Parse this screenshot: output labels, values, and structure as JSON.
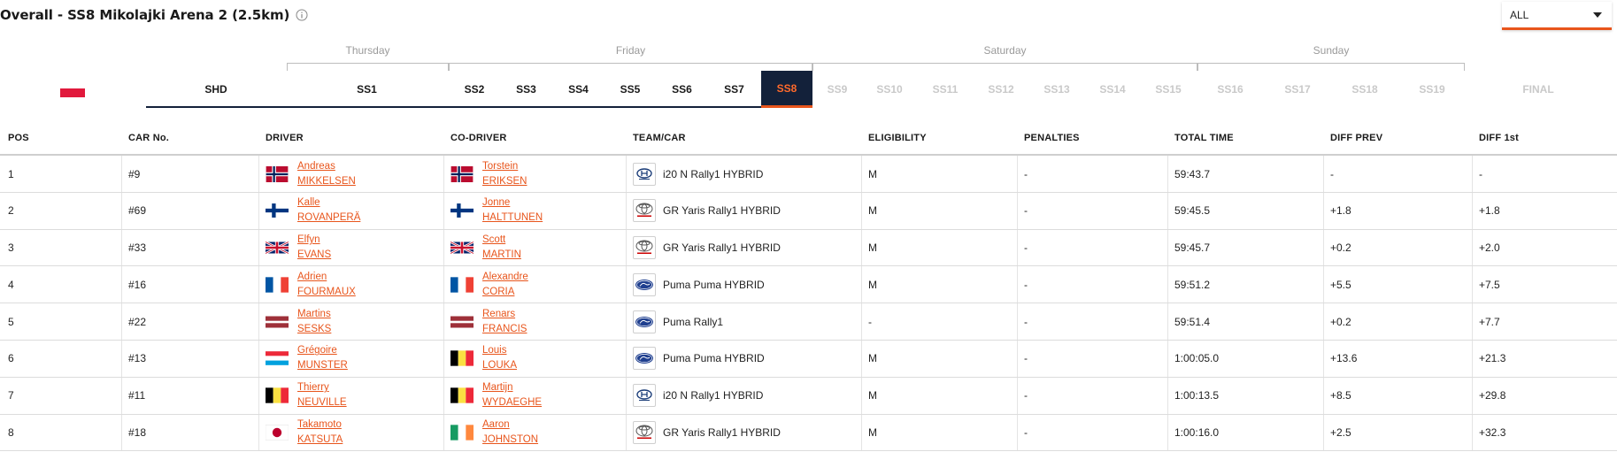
{
  "header": {
    "title": "Overall - SS8 Mikolajki Arena 2 (2.5km)",
    "filter_value": "ALL"
  },
  "days": [
    "Thursday",
    "Friday",
    "Saturday",
    "Sunday"
  ],
  "stages": [
    "SHD",
    "SS1",
    "SS2",
    "SS3",
    "SS4",
    "SS5",
    "SS6",
    "SS7",
    "SS8",
    "SS9",
    "SS10",
    "SS11",
    "SS12",
    "SS13",
    "SS14",
    "SS15",
    "SS16",
    "SS17",
    "SS18",
    "SS19",
    "FINAL"
  ],
  "active_stage": "SS8",
  "colors": {
    "accent": "#e8551c",
    "navy": "#13213a"
  },
  "columns": [
    "POS",
    "CAR No.",
    "DRIVER",
    "CO-DRIVER",
    "TEAM/CAR",
    "ELIGIBILITY",
    "PENALTIES",
    "TOTAL TIME",
    "DIFF PREV",
    "DIFF 1st"
  ],
  "rows": [
    {
      "pos": "1",
      "car": "#9",
      "driver_first": "Andreas",
      "driver_last": "MIKKELSEN",
      "driver_flag": "NOR",
      "codriver_first": "Torstein",
      "codriver_last": "ERIKSEN",
      "codriver_flag": "NOR",
      "logo": "hyundai-logo",
      "team": "i20 N Rally1 HYBRID",
      "elig": "M",
      "pen": "-",
      "total": "59:43.7",
      "diff_prev": "-",
      "diff_first": "-"
    },
    {
      "pos": "2",
      "car": "#69",
      "driver_first": "Kalle",
      "driver_last": "ROVANPERÄ",
      "driver_flag": "FIN",
      "codriver_first": "Jonne",
      "codriver_last": "HALTTUNEN",
      "codriver_flag": "FIN",
      "logo": "toyota-logo",
      "team": "GR Yaris Rally1 HYBRID",
      "elig": "M",
      "pen": "-",
      "total": "59:45.5",
      "diff_prev": "+1.8",
      "diff_first": "+1.8"
    },
    {
      "pos": "3",
      "car": "#33",
      "driver_first": "Elfyn",
      "driver_last": "EVANS",
      "driver_flag": "GBR",
      "codriver_first": "Scott",
      "codriver_last": "MARTIN",
      "codriver_flag": "GBR",
      "logo": "toyota-logo",
      "team": "GR Yaris Rally1 HYBRID",
      "elig": "M",
      "pen": "-",
      "total": "59:45.7",
      "diff_prev": "+0.2",
      "diff_first": "+2.0"
    },
    {
      "pos": "4",
      "car": "#16",
      "driver_first": "Adrien",
      "driver_last": "FOURMAUX",
      "driver_flag": "FRA",
      "codriver_first": "Alexandre",
      "codriver_last": "CORIA",
      "codriver_flag": "FRA",
      "logo": "ford-logo",
      "team": "Puma Puma HYBRID",
      "elig": "M",
      "pen": "-",
      "total": "59:51.2",
      "diff_prev": "+5.5",
      "diff_first": "+7.5"
    },
    {
      "pos": "5",
      "car": "#22",
      "driver_first": "Martins",
      "driver_last": "SESKS",
      "driver_flag": "LAT",
      "codriver_first": "Renars",
      "codriver_last": "FRANCIS",
      "codriver_flag": "LAT",
      "logo": "ford-logo",
      "team": "Puma Rally1",
      "elig": "-",
      "pen": "-",
      "total": "59:51.4",
      "diff_prev": "+0.2",
      "diff_first": "+7.7"
    },
    {
      "pos": "6",
      "car": "#13",
      "driver_first": "Grégoire",
      "driver_last": "MUNSTER",
      "driver_flag": "LUX",
      "codriver_first": "Louis",
      "codriver_last": "LOUKA",
      "codriver_flag": "BEL",
      "logo": "ford-logo",
      "team": "Puma Puma HYBRID",
      "elig": "M",
      "pen": "-",
      "total": "1:00:05.0",
      "diff_prev": "+13.6",
      "diff_first": "+21.3"
    },
    {
      "pos": "7",
      "car": "#11",
      "driver_first": "Thierry",
      "driver_last": "NEUVILLE",
      "driver_flag": "BEL",
      "codriver_first": "Martijn",
      "codriver_last": "WYDAEGHE",
      "codriver_flag": "BEL",
      "logo": "hyundai-logo",
      "team": "i20 N Rally1 HYBRID",
      "elig": "M",
      "pen": "-",
      "total": "1:00:13.5",
      "diff_prev": "+8.5",
      "diff_first": "+29.8"
    },
    {
      "pos": "8",
      "car": "#18",
      "driver_first": "Takamoto",
      "driver_last": "KATSUTA",
      "driver_flag": "JPN",
      "codriver_first": "Aaron",
      "codriver_last": "JOHNSTON",
      "codriver_flag": "IRL",
      "logo": "toyota-logo",
      "team": "GR Yaris Rally1 HYBRID",
      "elig": "M",
      "pen": "-",
      "total": "1:00:16.0",
      "diff_prev": "+2.5",
      "diff_first": "+32.3"
    }
  ]
}
